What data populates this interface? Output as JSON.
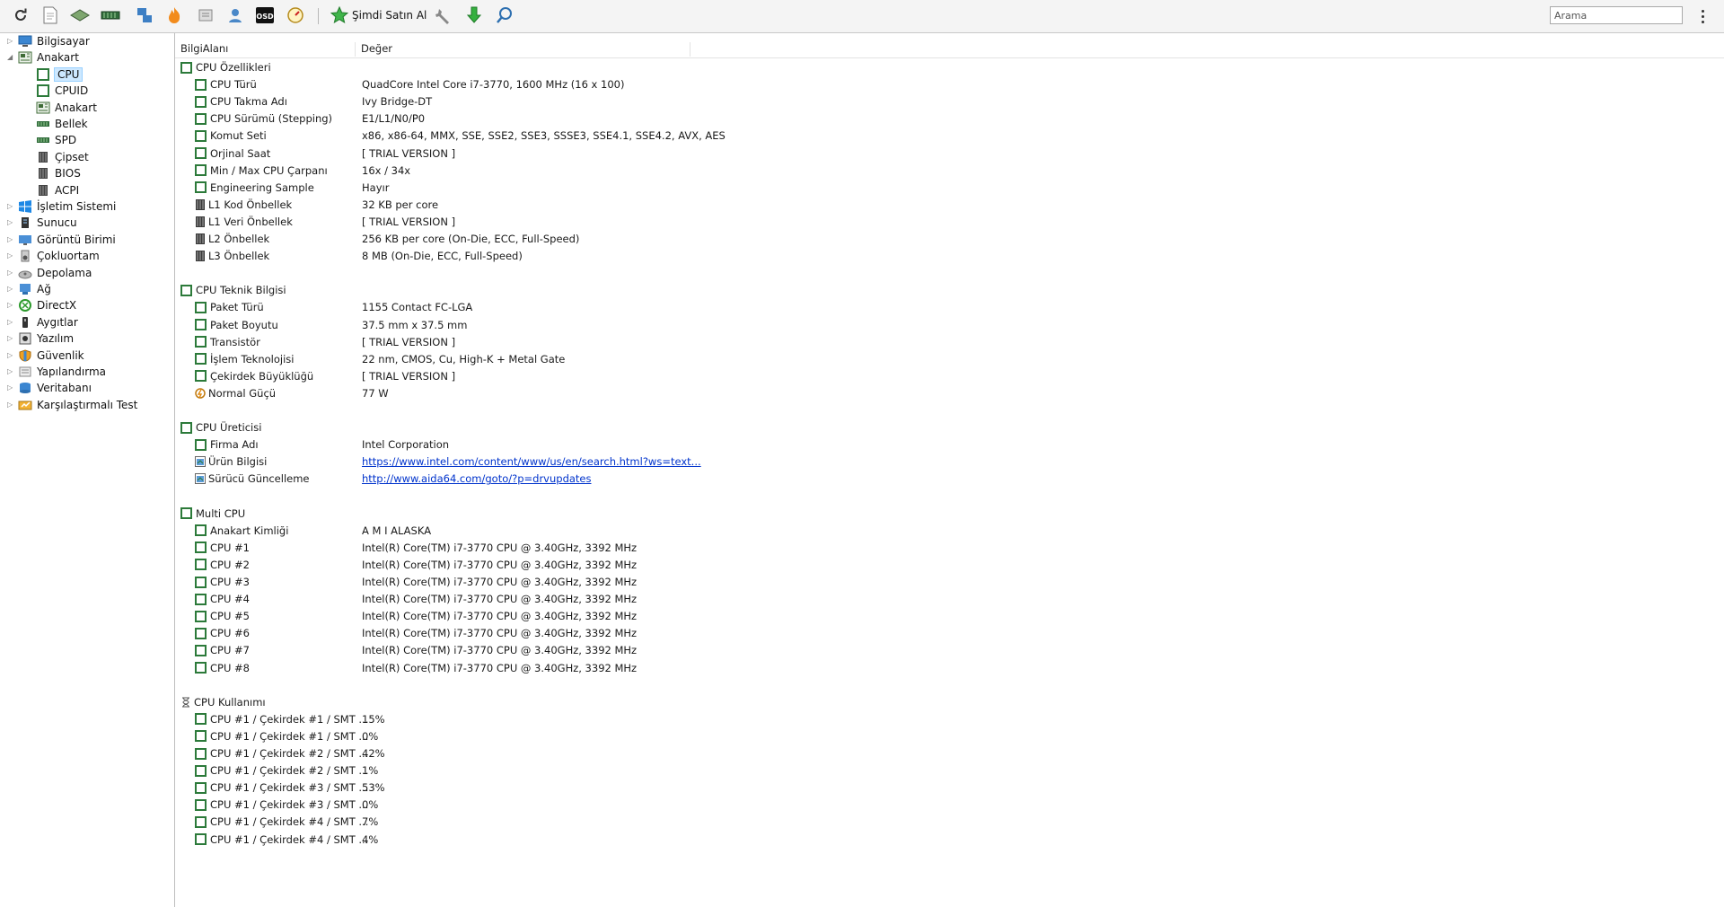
{
  "toolbar": {
    "icons": [
      "refresh-icon",
      "report-icon",
      "motherboard-icon",
      "memory-icon",
      "network-remote-icon",
      "flame-test-icon",
      "tools-icon",
      "user-icon",
      "osd-icon",
      "gauge-icon"
    ],
    "osd_text": "OSD",
    "buy_label": "Şimdi Satın Al",
    "search_placeholder": "Arama"
  },
  "tree": {
    "items": [
      {
        "label": "Bilgisayar",
        "level": 0,
        "expander": "▷",
        "icon": "computer"
      },
      {
        "label": "Anakart",
        "level": 0,
        "expander": "◢",
        "icon": "board"
      },
      {
        "label": "CPU",
        "level": 1,
        "icon": "cpu",
        "selected": true
      },
      {
        "label": "CPUID",
        "level": 1,
        "icon": "cpu"
      },
      {
        "label": "Anakart",
        "level": 1,
        "icon": "board"
      },
      {
        "label": "Bellek",
        "level": 1,
        "icon": "memory"
      },
      {
        "label": "SPD",
        "level": 1,
        "icon": "memory"
      },
      {
        "label": "Çipset",
        "level": 1,
        "icon": "chip"
      },
      {
        "label": "BIOS",
        "level": 1,
        "icon": "chip"
      },
      {
        "label": "ACPI",
        "level": 1,
        "icon": "chip"
      },
      {
        "label": "İşletim Sistemi",
        "level": 0,
        "expander": "▷",
        "icon": "windows"
      },
      {
        "label": "Sunucu",
        "level": 0,
        "expander": "▷",
        "icon": "server"
      },
      {
        "label": "Görüntü Birimi",
        "level": 0,
        "expander": "▷",
        "icon": "display"
      },
      {
        "label": "Çokluortam",
        "level": 0,
        "expander": "▷",
        "icon": "speaker"
      },
      {
        "label": "Depolama",
        "level": 0,
        "expander": "▷",
        "icon": "storage"
      },
      {
        "label": "Ağ",
        "level": 0,
        "expander": "▷",
        "icon": "network"
      },
      {
        "label": "DirectX",
        "level": 0,
        "expander": "▷",
        "icon": "directx"
      },
      {
        "label": "Aygıtlar",
        "level": 0,
        "expander": "▷",
        "icon": "device"
      },
      {
        "label": "Yazılım",
        "level": 0,
        "expander": "▷",
        "icon": "software"
      },
      {
        "label": "Güvenlik",
        "level": 0,
        "expander": "▷",
        "icon": "shield"
      },
      {
        "label": "Yapılandırma",
        "level": 0,
        "expander": "▷",
        "icon": "config"
      },
      {
        "label": "Veritabanı",
        "level": 0,
        "expander": "▷",
        "icon": "database"
      },
      {
        "label": "Karşılaştırmalı Test",
        "level": 0,
        "expander": "▷",
        "icon": "benchmark"
      }
    ]
  },
  "columns": {
    "field": "BilgiAlanı",
    "value": "Değer"
  },
  "groups": [
    {
      "title": "CPU Özellikleri",
      "icon": "square",
      "rows": [
        {
          "field": "CPU Türü",
          "value": "QuadCore Intel Core i7-3770, 1600 MHz (16 x 100)",
          "icon": "square"
        },
        {
          "field": "CPU Takma Adı",
          "value": "Ivy Bridge-DT",
          "icon": "square"
        },
        {
          "field": "CPU Sürümü (Stepping)",
          "value": "E1/L1/N0/P0",
          "icon": "square"
        },
        {
          "field": "Komut Seti",
          "value": "x86, x86-64, MMX, SSE, SSE2, SSE3, SSSE3, SSE4.1, SSE4.2, AVX, AES",
          "icon": "square"
        },
        {
          "field": "Orjinal Saat",
          "value": "[ TRIAL VERSION ]",
          "icon": "square"
        },
        {
          "field": "Min / Max CPU Çarpanı",
          "value": "16x / 34x",
          "icon": "square"
        },
        {
          "field": "Engineering Sample",
          "value": "Hayır",
          "icon": "square"
        },
        {
          "field": "L1 Kod Önbellek",
          "value": "32 KB per core",
          "icon": "bars"
        },
        {
          "field": "L1 Veri Önbellek",
          "value": "[ TRIAL VERSION ]",
          "icon": "bars"
        },
        {
          "field": "L2 Önbellek",
          "value": "256 KB per core  (On-Die, ECC, Full-Speed)",
          "icon": "bars"
        },
        {
          "field": "L3 Önbellek",
          "value": "8 MB  (On-Die, ECC, Full-Speed)",
          "icon": "bars"
        }
      ]
    },
    {
      "title": "CPU Teknik Bilgisi",
      "icon": "square",
      "rows": [
        {
          "field": "Paket Türü",
          "value": "1155 Contact FC-LGA",
          "icon": "square"
        },
        {
          "field": "Paket Boyutu",
          "value": "37.5 mm x 37.5 mm",
          "icon": "square"
        },
        {
          "field": "Transistör",
          "value": "[ TRIAL VERSION ]",
          "icon": "square"
        },
        {
          "field": "İşlem Teknolojisi",
          "value": "22 nm, CMOS, Cu, High-K + Metal Gate",
          "icon": "square"
        },
        {
          "field": "Çekirdek Büyüklüğü",
          "value": "[ TRIAL VERSION ]",
          "icon": "square"
        },
        {
          "field": "Normal Güçü",
          "value": "77 W",
          "icon": "power"
        }
      ]
    },
    {
      "title": "CPU Üreticisi",
      "icon": "square",
      "rows": [
        {
          "field": "Firma Adı",
          "value": "Intel Corporation",
          "icon": "square"
        },
        {
          "field": "Ürün Bilgisi",
          "value": "https://www.intel.com/content/www/us/en/search.html?ws=text...",
          "icon": "web",
          "link": true
        },
        {
          "field": "Sürücü Güncelleme",
          "value": "http://www.aida64.com/goto/?p=drvupdates",
          "icon": "web",
          "link": true
        }
      ]
    },
    {
      "title": "Multi CPU",
      "icon": "square",
      "rows": [
        {
          "field": "Anakart Kimliği",
          "value": "A M I ALASKA",
          "icon": "square"
        },
        {
          "field": "CPU #1",
          "value": "Intel(R) Core(TM) i7-3770 CPU @ 3.40GHz, 3392 MHz",
          "icon": "square"
        },
        {
          "field": "CPU #2",
          "value": "Intel(R) Core(TM) i7-3770 CPU @ 3.40GHz, 3392 MHz",
          "icon": "square"
        },
        {
          "field": "CPU #3",
          "value": "Intel(R) Core(TM) i7-3770 CPU @ 3.40GHz, 3392 MHz",
          "icon": "square"
        },
        {
          "field": "CPU #4",
          "value": "Intel(R) Core(TM) i7-3770 CPU @ 3.40GHz, 3392 MHz",
          "icon": "square"
        },
        {
          "field": "CPU #5",
          "value": "Intel(R) Core(TM) i7-3770 CPU @ 3.40GHz, 3392 MHz",
          "icon": "square"
        },
        {
          "field": "CPU #6",
          "value": "Intel(R) Core(TM) i7-3770 CPU @ 3.40GHz, 3392 MHz",
          "icon": "square"
        },
        {
          "field": "CPU #7",
          "value": "Intel(R) Core(TM) i7-3770 CPU @ 3.40GHz, 3392 MHz",
          "icon": "square"
        },
        {
          "field": "CPU #8",
          "value": "Intel(R) Core(TM) i7-3770 CPU @ 3.40GHz, 3392 MHz",
          "icon": "square"
        }
      ]
    },
    {
      "title": "CPU Kullanımı",
      "icon": "hourglass",
      "rows": [
        {
          "field": "CPU #1 / Çekirdek #1 / SMT ...",
          "value": "15%",
          "icon": "square"
        },
        {
          "field": "CPU #1 / Çekirdek #1 / SMT ...",
          "value": "0%",
          "icon": "square"
        },
        {
          "field": "CPU #1 / Çekirdek #2 / SMT ...",
          "value": "42%",
          "icon": "square"
        },
        {
          "field": "CPU #1 / Çekirdek #2 / SMT ...",
          "value": "1%",
          "icon": "square"
        },
        {
          "field": "CPU #1 / Çekirdek #3 / SMT ...",
          "value": "53%",
          "icon": "square"
        },
        {
          "field": "CPU #1 / Çekirdek #3 / SMT ...",
          "value": "0%",
          "icon": "square"
        },
        {
          "field": "CPU #1 / Çekirdek #4 / SMT ...",
          "value": "7%",
          "icon": "square"
        },
        {
          "field": "CPU #1 / Çekirdek #4 / SMT ...",
          "value": "4%",
          "icon": "square"
        }
      ]
    }
  ],
  "colors": {
    "accent_green": "#2c7a3a",
    "selection": "#cde8ff",
    "link": "#0033cc"
  }
}
